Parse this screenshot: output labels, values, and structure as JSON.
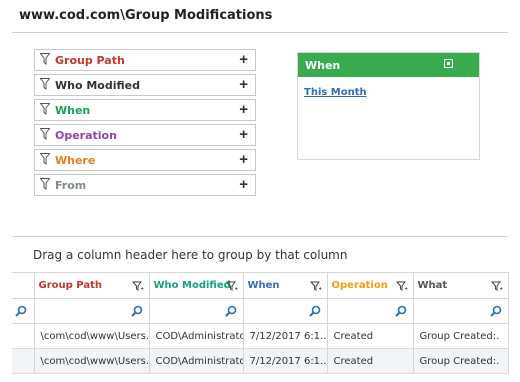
{
  "page": {
    "title": "www.cod.com\\Group Modifications"
  },
  "filters": [
    {
      "label": "Group Path",
      "color": "#c0392b"
    },
    {
      "label": "Who Modified",
      "color": "#333333"
    },
    {
      "label": "When",
      "color": "#1aa05a"
    },
    {
      "label": "Operation",
      "color": "#8e44ad"
    },
    {
      "label": "Where",
      "color": "#e67e22"
    },
    {
      "label": "From",
      "color": "#7f8c8d"
    }
  ],
  "when_panel": {
    "header": "When",
    "link": "This Month",
    "header_color": "#3aaa4f"
  },
  "grid": {
    "group_hint": "Drag a column header here to group by that column",
    "columns": [
      "Group Path",
      "Who Modified",
      "When",
      "Operation",
      "What"
    ],
    "rows": [
      [
        "\\com\\cod\\www\\Users...",
        "COD\\Administrator",
        "7/12/2017 6:1...",
        "Created",
        "Group Created:."
      ],
      [
        "\\com\\cod\\www\\Users...",
        "COD\\Administrator",
        "7/12/2017 6:1...",
        "Created",
        "Group Created:."
      ]
    ]
  }
}
